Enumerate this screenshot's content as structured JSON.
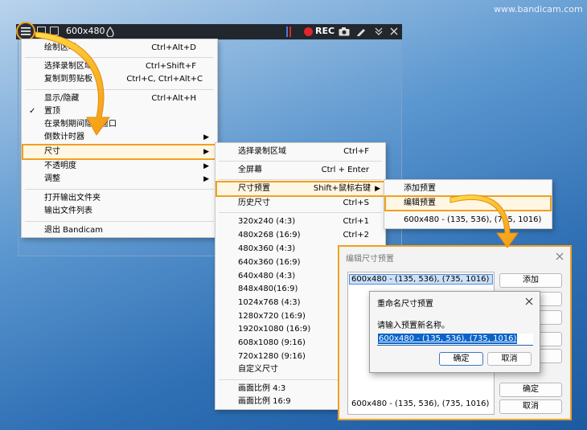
{
  "watermark": "www.bandicam.com",
  "toolbar": {
    "size_label": "600x480",
    "rec_label": "REC",
    "icons": [
      "menu-icon",
      "rect-icon",
      "window-icon",
      "drop-icon",
      "pause-icon",
      "record-dot-icon",
      "camera-icon",
      "pencil-icon",
      "collapse-icon",
      "close-icon"
    ]
  },
  "main_menu": {
    "items": [
      {
        "label": "绘制区域",
        "shortcut": "Ctrl+Alt+D"
      },
      {
        "label": "选择录制区域",
        "shortcut": "Ctrl+Shift+F"
      },
      {
        "label": "复制到剪贴板",
        "shortcut": "Ctrl+C, Ctrl+Alt+C"
      },
      {
        "label": "显示/隐藏",
        "shortcut": "Ctrl+Alt+H"
      },
      {
        "label": "置顶",
        "shortcut": ""
      },
      {
        "label": "在录制期间隐藏窗口",
        "shortcut": ""
      },
      {
        "label": "倒数计时器",
        "shortcut": ""
      },
      {
        "label": "尺寸",
        "shortcut": ""
      },
      {
        "label": "不透明度",
        "shortcut": ""
      },
      {
        "label": "调整",
        "shortcut": ""
      },
      {
        "label": "打开输出文件夹",
        "shortcut": ""
      },
      {
        "label": "输出文件列表",
        "shortcut": ""
      },
      {
        "label": "退出 Bandicam",
        "shortcut": ""
      }
    ],
    "check": "✓"
  },
  "size_menu": {
    "items": [
      {
        "label": "选择录制区域",
        "shortcut": "Ctrl+F"
      },
      {
        "label": "全屏幕",
        "shortcut": "Ctrl + Enter"
      },
      {
        "label": "尺寸预置",
        "shortcut": "Shift+鼠标右键"
      },
      {
        "label": "历史尺寸",
        "shortcut": "Ctrl+S"
      },
      {
        "label": "320x240 (4:3)",
        "shortcut": "Ctrl+1"
      },
      {
        "label": "480x268 (16:9)",
        "shortcut": "Ctrl+2"
      },
      {
        "label": "480x360 (4:3)",
        "shortcut": ""
      },
      {
        "label": "640x360 (16:9)",
        "shortcut": ""
      },
      {
        "label": "640x480 (4:3)",
        "shortcut": ""
      },
      {
        "label": "848x480(16:9)",
        "shortcut": ""
      },
      {
        "label": "1024x768 (4:3)",
        "shortcut": ""
      },
      {
        "label": "1280x720 (16:9)",
        "shortcut": ""
      },
      {
        "label": "1920x1080 (16:9)",
        "shortcut": ""
      },
      {
        "label": "608x1080 (9:16)",
        "shortcut": ""
      },
      {
        "label": "720x1280 (9:16)",
        "shortcut": ""
      },
      {
        "label": "自定义尺寸",
        "shortcut": ""
      },
      {
        "label": "画面比例 4:3",
        "shortcut": ""
      },
      {
        "label": "画面比例 16:9",
        "shortcut": ""
      }
    ]
  },
  "preset_menu": {
    "items": [
      {
        "label": "添加预置"
      },
      {
        "label": "编辑预置"
      },
      {
        "label": "600x480 - (135, 536), (735, 1016)"
      }
    ]
  },
  "edit_dialog": {
    "title": "编辑尺寸预置",
    "list_item": "600x480 - (135, 536), (735, 1016)",
    "add_button": "添加",
    "bottom_value": "600x480 - (135, 536), (735, 1016)",
    "ok_button": "确定",
    "cancel_button": "取消"
  },
  "rename_dialog": {
    "title": "重命名尺寸预置",
    "prompt": "请输入预置新名称。",
    "input_value": "600x480 - (135, 536), (735, 1016)",
    "ok_button": "确定",
    "cancel_button": "取消"
  },
  "colors": {
    "accent": "#f0a020",
    "selection": "#0a64c8",
    "toolbar": "#22272e",
    "rec": "#e0262c"
  }
}
